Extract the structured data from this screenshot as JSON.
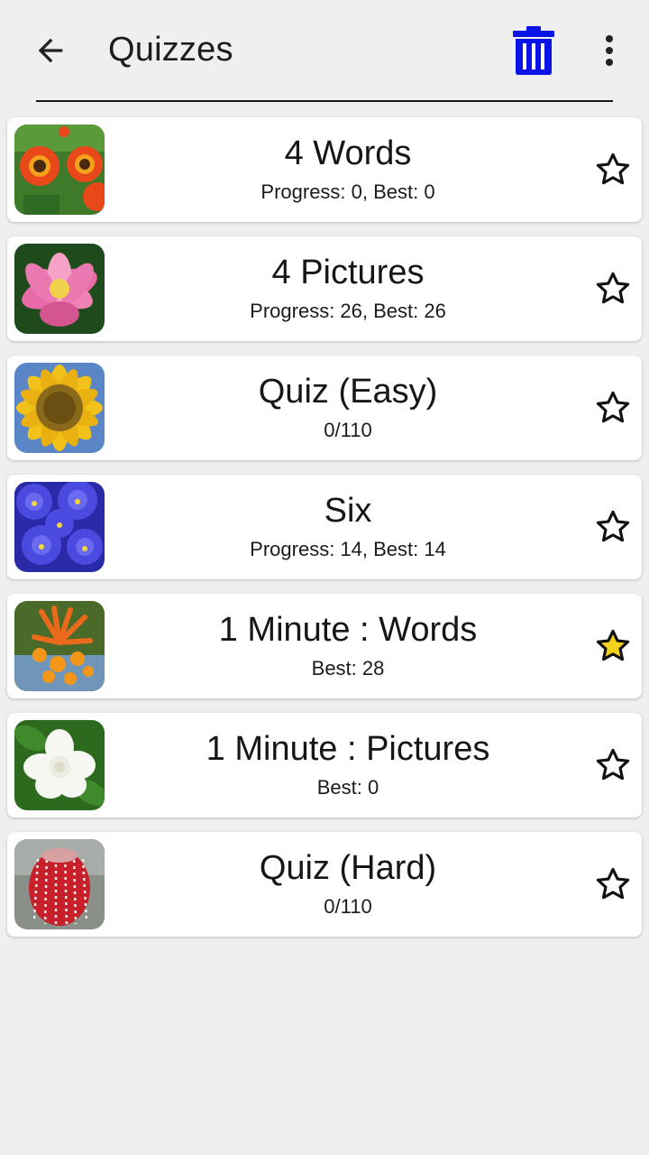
{
  "app_bar": {
    "title": "Quizzes",
    "back_icon": "arrow-back-icon",
    "delete_icon": "trash-icon",
    "menu_icon": "more-vertical-icon",
    "delete_color": "#0a14e6"
  },
  "quizzes": [
    {
      "title": "4 Words",
      "subtitle": "Progress: 0, Best: 0",
      "image": "red-orange-daisy-flowers",
      "favorite": false
    },
    {
      "title": "4 Pictures",
      "subtitle": "Progress: 26, Best: 26",
      "image": "pink-lotus-flower",
      "favorite": false
    },
    {
      "title": "Quiz (Easy)",
      "subtitle": "0/110",
      "image": "sunflower",
      "favorite": false
    },
    {
      "title": "Six",
      "subtitle": "Progress: 14, Best: 14",
      "image": "blue-violet-pansies",
      "favorite": false
    },
    {
      "title": "1 Minute : Words",
      "subtitle": "Best: 28",
      "image": "orange-tubular-flowers",
      "favorite": true
    },
    {
      "title": "1 Minute : Pictures",
      "subtitle": "Best: 0",
      "image": "white-gardenia",
      "favorite": false
    },
    {
      "title": "Quiz (Hard)",
      "subtitle": "0/110",
      "image": "red-banksia",
      "favorite": false
    }
  ],
  "colors": {
    "background": "#efefef",
    "card": "#ffffff",
    "star_filled": "#f2d21c",
    "star_outline": "#111111"
  }
}
